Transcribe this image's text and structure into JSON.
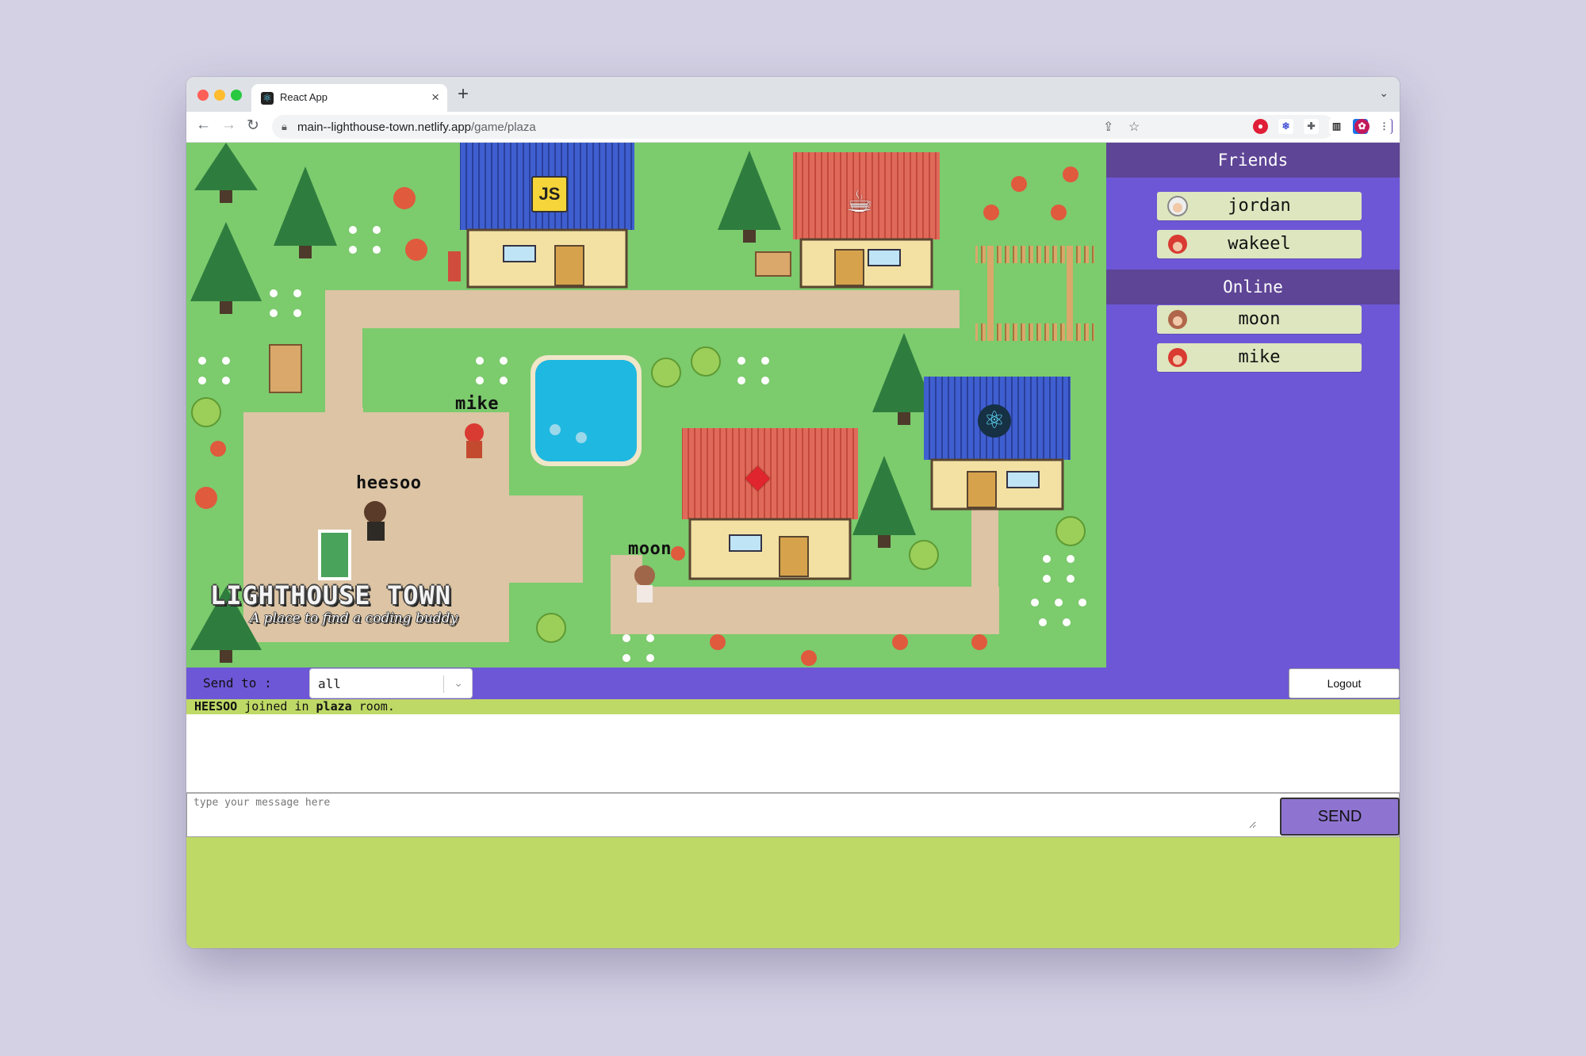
{
  "browser": {
    "tab_title": "React App",
    "url_host": "main--lighthouse-town.netlify.app",
    "url_path": "/game/plaza"
  },
  "map": {
    "players": [
      {
        "name": "mike"
      },
      {
        "name": "heesoo"
      },
      {
        "name": "moon"
      }
    ],
    "buildings": [
      {
        "icon": "javascript-icon",
        "label": "JS"
      },
      {
        "icon": "coffee-icon"
      },
      {
        "icon": "ruby-icon"
      },
      {
        "icon": "react-icon"
      }
    ],
    "logo": {
      "title": "LIGHTHOUSE TOWN",
      "subtitle": "A place to find a coding buddy",
      "letter": "L"
    }
  },
  "sidebar": {
    "friends_header": "Friends",
    "friends": [
      {
        "name": "jordan",
        "avatar": "old-man-avatar"
      },
      {
        "name": "wakeel",
        "avatar": "red-cap-avatar"
      }
    ],
    "online_header": "Online",
    "online": [
      {
        "name": "moon",
        "avatar": "girl-avatar"
      },
      {
        "name": "mike",
        "avatar": "red-cap-avatar"
      }
    ]
  },
  "chat": {
    "send_to_label": "Send to :",
    "send_to_value": "all",
    "logout_label": "Logout",
    "message": {
      "user": "HEESOO",
      "text1": " joined in ",
      "room": "plaza",
      "text2": " room."
    },
    "input_placeholder": "type your message here",
    "send_label": "SEND"
  },
  "colors": {
    "sidebar_purple": "#6e57d6",
    "header_purple": "#5e4596",
    "pill_green": "#dde6bf",
    "lime": "#bfd966",
    "grass": "#7ccb6d",
    "path": "#dcc4a4",
    "water": "#1fb8e0"
  }
}
